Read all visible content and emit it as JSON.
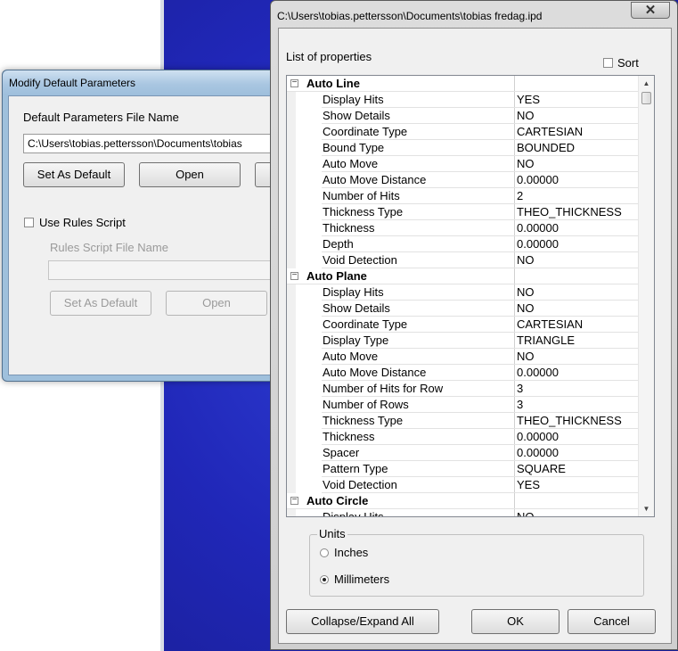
{
  "back_dialog": {
    "title": "Modify Default Parameters",
    "file_label": "Default Parameters File Name",
    "file_path": "C:\\Users\\tobias.pettersson\\Documents\\tobias",
    "set_default_label": "Set As Default",
    "open_label": "Open",
    "use_rules_label": "Use Rules Script",
    "rules_file_label": "Rules Script File Name",
    "rules_file_value": "",
    "rules_set_default_label": "Set As Default",
    "rules_open_label": "Open"
  },
  "front_dialog": {
    "title": "C:\\Users\\tobias.pettersson\\Documents\\tobias fredag.ipd",
    "close_glyph": "✕",
    "list_label": "List of properties",
    "sort_label": "Sort",
    "categories": [
      {
        "name": "Auto Line",
        "expander": "−",
        "rows": [
          {
            "name": "Display Hits",
            "value": "YES"
          },
          {
            "name": "Show Details",
            "value": "NO"
          },
          {
            "name": "Coordinate Type",
            "value": "CARTESIAN"
          },
          {
            "name": "Bound Type",
            "value": "BOUNDED"
          },
          {
            "name": "Auto Move",
            "value": "NO"
          },
          {
            "name": "Auto Move Distance",
            "value": "0.00000"
          },
          {
            "name": "Number of Hits",
            "value": "2"
          },
          {
            "name": "Thickness Type",
            "value": "THEO_THICKNESS"
          },
          {
            "name": "Thickness",
            "value": "0.00000"
          },
          {
            "name": "Depth",
            "value": "0.00000"
          },
          {
            "name": "Void Detection",
            "value": "NO"
          }
        ]
      },
      {
        "name": "Auto Plane",
        "expander": "−",
        "rows": [
          {
            "name": "Display Hits",
            "value": "NO"
          },
          {
            "name": "Show Details",
            "value": "NO"
          },
          {
            "name": "Coordinate Type",
            "value": "CARTESIAN"
          },
          {
            "name": "Display Type",
            "value": "TRIANGLE"
          },
          {
            "name": "Auto Move",
            "value": "NO"
          },
          {
            "name": "Auto Move Distance",
            "value": "0.00000"
          },
          {
            "name": "Number of Hits for Row",
            "value": "3"
          },
          {
            "name": "Number of Rows",
            "value": "3"
          },
          {
            "name": "Thickness Type",
            "value": "THEO_THICKNESS"
          },
          {
            "name": "Thickness",
            "value": "0.00000"
          },
          {
            "name": "Spacer",
            "value": "0.00000"
          },
          {
            "name": "Pattern Type",
            "value": "SQUARE"
          },
          {
            "name": "Void Detection",
            "value": "YES"
          }
        ]
      },
      {
        "name": "Auto Circle",
        "expander": "−",
        "rows": [
          {
            "name": "Display Hits",
            "value": "NO"
          }
        ]
      }
    ],
    "scroll_up_glyph": "▲",
    "scroll_down_glyph": "▼",
    "units": {
      "title": "Units",
      "inches_label": "Inches",
      "millimeters_label": "Millimeters",
      "selected": "Millimeters"
    },
    "collapse_label": "Collapse/Expand All",
    "ok_label": "OK",
    "cancel_label": "Cancel"
  }
}
